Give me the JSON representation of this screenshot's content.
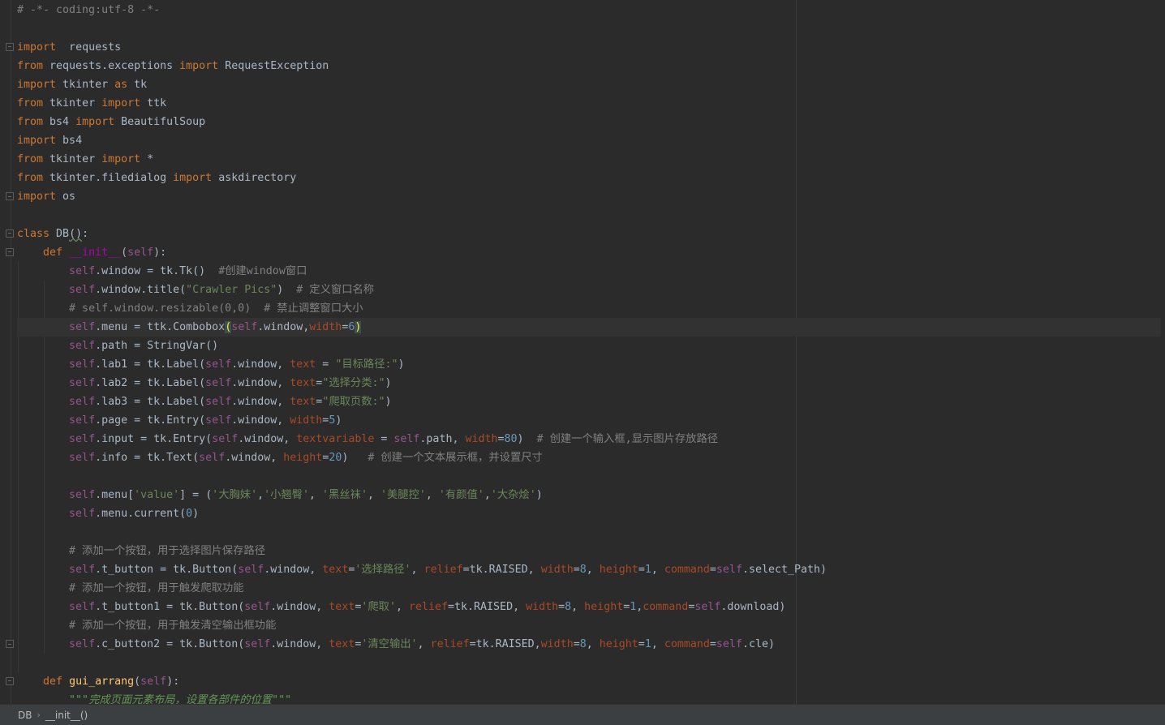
{
  "editor": {
    "lines": [
      [
        [
          "cmt",
          "# -*- coding:utf-8 -*-"
        ]
      ],
      [],
      [
        [
          "kw",
          "import"
        ],
        [
          "",
          "  requests"
        ]
      ],
      [
        [
          "kw",
          "from"
        ],
        [
          "",
          " requests.exceptions "
        ],
        [
          "kw",
          "import"
        ],
        [
          "",
          " RequestException"
        ]
      ],
      [
        [
          "kw",
          "import"
        ],
        [
          "",
          " tkinter "
        ],
        [
          "kw",
          "as"
        ],
        [
          "",
          " tk"
        ]
      ],
      [
        [
          "kw",
          "from"
        ],
        [
          "",
          " tkinter "
        ],
        [
          "kw",
          "import"
        ],
        [
          "",
          " ttk"
        ]
      ],
      [
        [
          "kw",
          "from"
        ],
        [
          "",
          " bs4 "
        ],
        [
          "kw",
          "import"
        ],
        [
          "",
          " BeautifulSoup"
        ]
      ],
      [
        [
          "kw",
          "import"
        ],
        [
          "",
          " bs4"
        ]
      ],
      [
        [
          "kw",
          "from"
        ],
        [
          "",
          " tkinter "
        ],
        [
          "kw",
          "import"
        ],
        [
          "",
          " *"
        ]
      ],
      [
        [
          "kw",
          "from"
        ],
        [
          "",
          " tkinter.filedialog "
        ],
        [
          "kw",
          "import"
        ],
        [
          "",
          " askdirectory"
        ]
      ],
      [
        [
          "kw",
          "import"
        ],
        [
          "",
          " os"
        ]
      ],
      [],
      [
        [
          "kw",
          "class"
        ],
        [
          "",
          " DB"
        ],
        [
          "squig",
          "()"
        ],
        [
          ":"
        ]
      ],
      [
        [
          "",
          "    "
        ],
        [
          "kw",
          "def"
        ],
        [
          "",
          " "
        ],
        [
          "magic",
          "__init__"
        ],
        [
          "",
          "("
        ],
        [
          "self",
          "self"
        ],
        [
          "",
          "):"
        ]
      ],
      [
        [
          "",
          "        "
        ],
        [
          "self",
          "self"
        ],
        [
          ".window = tk.Tk()  "
        ],
        [
          "cmt",
          "#创建window窗口"
        ]
      ],
      [
        [
          "",
          "        "
        ],
        [
          "self",
          "self"
        ],
        [
          ".window.title("
        ],
        [
          "str",
          "\"Crawler Pics\""
        ],
        [
          ")  "
        ],
        [
          "cmt",
          "# 定义窗口名称"
        ]
      ],
      [
        [
          "",
          "        "
        ],
        [
          "cmt",
          "# self.window.resizable(0,0)  # 禁止调整窗口大小"
        ]
      ],
      [
        [
          "",
          "        "
        ],
        [
          "self",
          "self"
        ],
        [
          ".menu = ttk.Combobox"
        ],
        [
          "bracehl",
          "("
        ],
        [
          "self",
          "self"
        ],
        [
          ".window,"
        ],
        [
          "param",
          "width"
        ],
        [
          "",
          "="
        ],
        [
          "num",
          "6"
        ],
        [
          "bracehl",
          ")"
        ]
      ],
      [
        [
          "",
          "        "
        ],
        [
          "self",
          "self"
        ],
        [
          ".path = StringVar()"
        ]
      ],
      [
        [
          "",
          "        "
        ],
        [
          "self",
          "self"
        ],
        [
          ".lab1 = tk.Label("
        ],
        [
          "self",
          "self"
        ],
        [
          ".window, "
        ],
        [
          "param",
          "text"
        ],
        [
          "",
          " = "
        ],
        [
          "str",
          "\"目标路径:\""
        ],
        [
          ")"
        ]
      ],
      [
        [
          "",
          "        "
        ],
        [
          "self",
          "self"
        ],
        [
          ".lab2 = tk.Label("
        ],
        [
          "self",
          "self"
        ],
        [
          ".window, "
        ],
        [
          "param",
          "text"
        ],
        [
          "",
          "="
        ],
        [
          "str",
          "\"选择分类:\""
        ],
        [
          ")"
        ]
      ],
      [
        [
          "",
          "        "
        ],
        [
          "self",
          "self"
        ],
        [
          ".lab3 = tk.Label("
        ],
        [
          "self",
          "self"
        ],
        [
          ".window, "
        ],
        [
          "param",
          "text"
        ],
        [
          "",
          "="
        ],
        [
          "str",
          "\"爬取页数:\""
        ],
        [
          ")"
        ]
      ],
      [
        [
          "",
          "        "
        ],
        [
          "self",
          "self"
        ],
        [
          ".page = tk.Entry("
        ],
        [
          "self",
          "self"
        ],
        [
          ".window, "
        ],
        [
          "param",
          "width"
        ],
        [
          "",
          "="
        ],
        [
          "num",
          "5"
        ],
        [
          ")"
        ]
      ],
      [
        [
          "",
          "        "
        ],
        [
          "self",
          "self"
        ],
        [
          ".input = tk.Entry("
        ],
        [
          "self",
          "self"
        ],
        [
          ".window, "
        ],
        [
          "param",
          "textvariable"
        ],
        [
          "",
          " = "
        ],
        [
          "self",
          "self"
        ],
        [
          ".path, "
        ],
        [
          "param",
          "width"
        ],
        [
          "",
          "="
        ],
        [
          "num",
          "80"
        ],
        [
          ")  "
        ],
        [
          "cmt",
          "# 创建一个输入框,显示图片存放路径"
        ]
      ],
      [
        [
          "",
          "        "
        ],
        [
          "self",
          "self"
        ],
        [
          ".info = tk.Text("
        ],
        [
          "self",
          "self"
        ],
        [
          ".window, "
        ],
        [
          "param",
          "height"
        ],
        [
          "",
          "="
        ],
        [
          "num",
          "20"
        ],
        [
          ")   "
        ],
        [
          "cmt",
          "# 创建一个文本展示框，并设置尺寸"
        ]
      ],
      [],
      [
        [
          "",
          "        "
        ],
        [
          "self",
          "self"
        ],
        [
          ".menu["
        ],
        [
          "str",
          "'value'"
        ],
        [
          "",
          "] = ("
        ],
        [
          "str",
          "'大胸妹'"
        ],
        [
          ","
        ],
        [
          "str",
          "'小翘臀'"
        ],
        [
          ", "
        ],
        [
          "str",
          "'黑丝袜'"
        ],
        [
          ", "
        ],
        [
          "str",
          "'美腿控'"
        ],
        [
          ", "
        ],
        [
          "str",
          "'有颜值'"
        ],
        [
          ","
        ],
        [
          "str",
          "'大杂烩'"
        ],
        [
          ")"
        ]
      ],
      [
        [
          "",
          "        "
        ],
        [
          "self",
          "self"
        ],
        [
          ".menu.current("
        ],
        [
          "num",
          "0"
        ],
        [
          ")"
        ]
      ],
      [],
      [
        [
          "",
          "        "
        ],
        [
          "cmt",
          "# 添加一个按钮，用于选择图片保存路径"
        ]
      ],
      [
        [
          "",
          "        "
        ],
        [
          "self",
          "self"
        ],
        [
          ".t_button = tk.Button("
        ],
        [
          "self",
          "self"
        ],
        [
          ".window, "
        ],
        [
          "param",
          "text"
        ],
        [
          "",
          "="
        ],
        [
          "str",
          "'选择路径'"
        ],
        [
          ", "
        ],
        [
          "param",
          "relief"
        ],
        [
          "",
          "=tk.RAISED, "
        ],
        [
          "param",
          "width"
        ],
        [
          "",
          "="
        ],
        [
          "num",
          "8"
        ],
        [
          ", "
        ],
        [
          "param",
          "height"
        ],
        [
          "",
          "="
        ],
        [
          "num",
          "1"
        ],
        [
          ", "
        ],
        [
          "param",
          "command"
        ],
        [
          "",
          "="
        ],
        [
          "self",
          "self"
        ],
        [
          ".select_Path)"
        ]
      ],
      [
        [
          "",
          "        "
        ],
        [
          "cmt",
          "# 添加一个按钮，用于触发爬取功能"
        ]
      ],
      [
        [
          "",
          "        "
        ],
        [
          "self",
          "self"
        ],
        [
          ".t_button1 = tk.Button("
        ],
        [
          "self",
          "self"
        ],
        [
          ".window, "
        ],
        [
          "param",
          "text"
        ],
        [
          "",
          "="
        ],
        [
          "str",
          "'爬取'"
        ],
        [
          ", "
        ],
        [
          "param",
          "relief"
        ],
        [
          "",
          "=tk.RAISED, "
        ],
        [
          "param",
          "width"
        ],
        [
          "",
          "="
        ],
        [
          "num",
          "8"
        ],
        [
          ", "
        ],
        [
          "param",
          "height"
        ],
        [
          "",
          "="
        ],
        [
          "num",
          "1"
        ],
        [
          ","
        ],
        [
          "param",
          "command"
        ],
        [
          "",
          "="
        ],
        [
          "self",
          "self"
        ],
        [
          ".download)"
        ]
      ],
      [
        [
          "",
          "        "
        ],
        [
          "cmt",
          "# 添加一个按钮，用于触发清空输出框功能"
        ]
      ],
      [
        [
          "",
          "        "
        ],
        [
          "self",
          "self"
        ],
        [
          ".c_button2 = tk.Button("
        ],
        [
          "self",
          "self"
        ],
        [
          ".window, "
        ],
        [
          "param",
          "text"
        ],
        [
          "",
          "="
        ],
        [
          "str",
          "'清空输出'"
        ],
        [
          ", "
        ],
        [
          "param",
          "relief"
        ],
        [
          "",
          "=tk.RAISED,"
        ],
        [
          "param",
          "width"
        ],
        [
          "",
          "="
        ],
        [
          "num",
          "8"
        ],
        [
          ", "
        ],
        [
          "param",
          "height"
        ],
        [
          "",
          "="
        ],
        [
          "num",
          "1"
        ],
        [
          ", "
        ],
        [
          "param",
          "command"
        ],
        [
          "",
          "="
        ],
        [
          "self",
          "self"
        ],
        [
          ".cle)"
        ]
      ],
      [],
      [
        [
          "",
          "    "
        ],
        [
          "kw",
          "def"
        ],
        [
          "",
          " "
        ],
        [
          "fn",
          "gui_arrang"
        ],
        [
          "",
          "("
        ],
        [
          "self",
          "self"
        ],
        [
          "",
          "):"
        ]
      ],
      [
        [
          "",
          "        "
        ],
        [
          "doc",
          "\"\"\"完成页面元素布局，设置各部件的位置\"\"\""
        ]
      ]
    ],
    "current_line": 17
  },
  "statusbar": {
    "crumbs": [
      "DB",
      "__init__()"
    ]
  }
}
